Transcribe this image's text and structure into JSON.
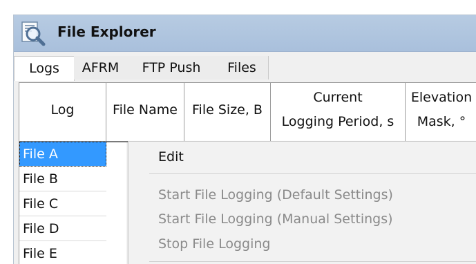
{
  "window": {
    "title": "File Explorer",
    "icon": "magnifier-document-icon"
  },
  "tabs": [
    {
      "label": "Logs",
      "active": true
    },
    {
      "label": "AFRM",
      "active": false
    },
    {
      "label": "FTP Push",
      "active": false
    },
    {
      "label": "Files",
      "active": false
    }
  ],
  "table": {
    "columns": [
      {
        "lines": [
          "Log"
        ]
      },
      {
        "lines": [
          "File Name"
        ]
      },
      {
        "lines": [
          "File Size, B"
        ]
      },
      {
        "lines": [
          "Current",
          "Logging Period, s"
        ]
      },
      {
        "lines": [
          "Elevation",
          "Mask, °"
        ]
      }
    ],
    "rows": [
      {
        "log": "File A",
        "selected": true
      },
      {
        "log": "File B",
        "selected": false
      },
      {
        "log": "File C",
        "selected": false
      },
      {
        "log": "File D",
        "selected": false
      },
      {
        "log": "File E",
        "selected": false
      }
    ]
  },
  "context_menu": {
    "items": [
      {
        "label": "Edit",
        "enabled": true
      },
      {
        "separator": true
      },
      {
        "label": "Start File Logging (Default Settings)",
        "enabled": false
      },
      {
        "label": "Start File Logging (Manual Settings)",
        "enabled": false
      },
      {
        "label": "Stop File Logging",
        "enabled": false
      },
      {
        "separator": true
      }
    ]
  },
  "colors": {
    "titlebar": "#b7cbe2",
    "selection": "#3399ff",
    "disabled_text": "#8a8a8a"
  }
}
